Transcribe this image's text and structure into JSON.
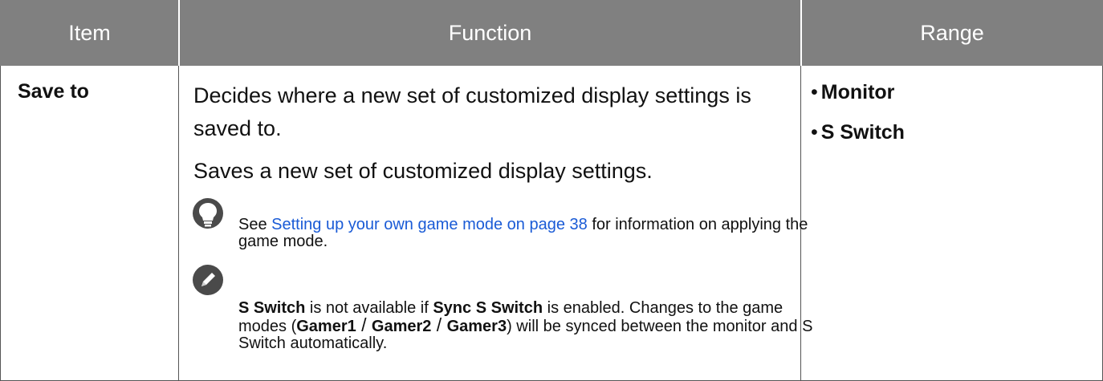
{
  "header": {
    "item": "Item",
    "function": "Function",
    "range": "Range"
  },
  "row": {
    "item": "Save to",
    "func_p1": "Decides where a new set of customized display settings is saved to.",
    "func_p2": "Saves a new set of customized display settings.",
    "range_items": [
      "Monitor",
      "S Switch"
    ],
    "range_bullet": "•"
  },
  "tip": {
    "icon": "lightbulb-icon",
    "prefix": "See ",
    "link": "Setting up your own game mode on page 38",
    "suffix": " for information on applying the game mode."
  },
  "note": {
    "icon": "pencil-icon",
    "s1": "S Switch",
    "t1": " is not available if ",
    "s2": "Sync S Switch",
    "t2": " is enabled. Changes to the game modes (",
    "g1": "Gamer1",
    "sep1": " / ",
    "g2": "Gamer2",
    "sep2": " / ",
    "g3": "Gamer3",
    "t3": ") will be synced between the monitor and S Switch automatically."
  },
  "colors": {
    "header_bg": "#808080",
    "link": "#1a5bd6",
    "icon": "#4a4a4a"
  }
}
